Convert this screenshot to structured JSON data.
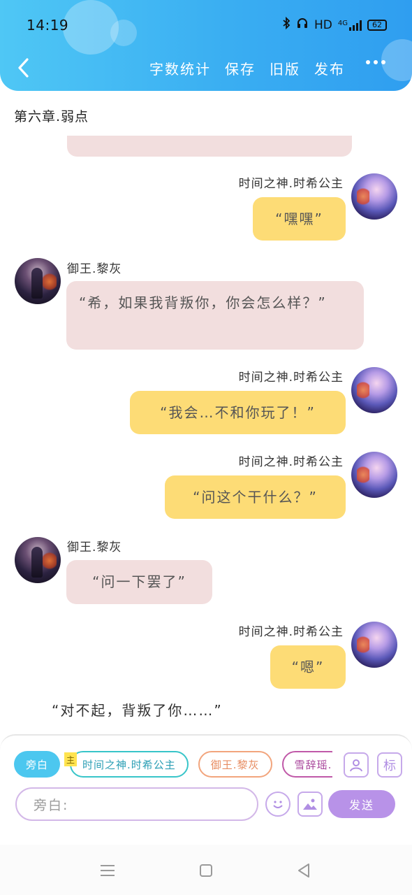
{
  "status_bar": {
    "time": "14:19",
    "hd": "HD",
    "network": "4G",
    "battery": "62"
  },
  "header": {
    "actions": [
      "字数统计",
      "保存",
      "旧版",
      "发布"
    ],
    "accent": "#3aaef2"
  },
  "chapter": {
    "title": "第六章.弱点"
  },
  "messages": [
    {
      "speaker": "时间之神.时希公主",
      "text": "“嘿嘿”"
    },
    {
      "speaker": "御王.黎灰",
      "text": "“希，如果我背叛你，你会怎么样？”"
    },
    {
      "speaker": "时间之神.时希公主",
      "text": "“我会…不和你玩了！”"
    },
    {
      "speaker": "时间之神.时希公主",
      "text": "“问这个干什么？”"
    },
    {
      "speaker": "御王.黎灰",
      "text": "“问一下罢了”"
    },
    {
      "speaker": "时间之神.时希公主",
      "text": "“嗯”"
    }
  ],
  "narration": "“对不起，背叛了你……”",
  "input_panel": {
    "chips": [
      {
        "label": "旁白"
      },
      {
        "label": "时间之神.时希公主",
        "tag": "主"
      },
      {
        "label": "御王.黎灰"
      },
      {
        "label": "雪辞瑶."
      }
    ],
    "label_button": "标",
    "placeholder": "旁白:",
    "send_label": "发送",
    "colors": {
      "me_bubble": "#fddc76",
      "them_bubble": "#f2dede",
      "send": "#b892e8"
    }
  }
}
